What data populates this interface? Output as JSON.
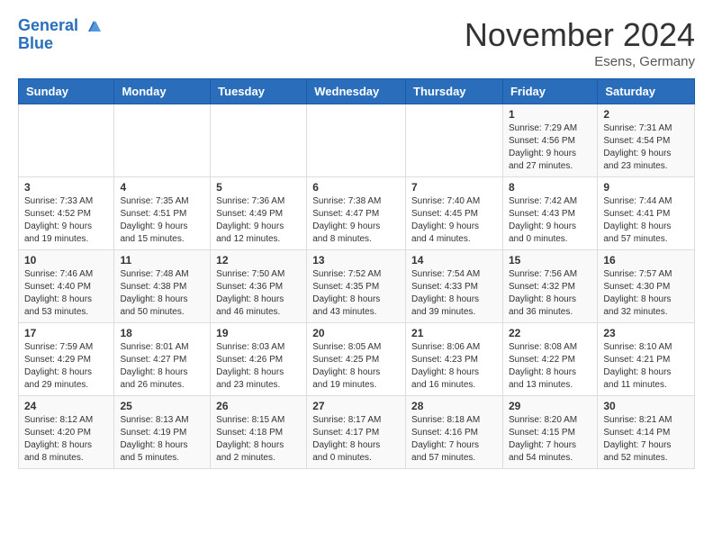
{
  "header": {
    "logo_line1": "General",
    "logo_line2": "Blue",
    "month_title": "November 2024",
    "location": "Esens, Germany"
  },
  "days_of_week": [
    "Sunday",
    "Monday",
    "Tuesday",
    "Wednesday",
    "Thursday",
    "Friday",
    "Saturday"
  ],
  "weeks": [
    [
      {
        "num": "",
        "info": ""
      },
      {
        "num": "",
        "info": ""
      },
      {
        "num": "",
        "info": ""
      },
      {
        "num": "",
        "info": ""
      },
      {
        "num": "",
        "info": ""
      },
      {
        "num": "1",
        "info": "Sunrise: 7:29 AM\nSunset: 4:56 PM\nDaylight: 9 hours\nand 27 minutes."
      },
      {
        "num": "2",
        "info": "Sunrise: 7:31 AM\nSunset: 4:54 PM\nDaylight: 9 hours\nand 23 minutes."
      }
    ],
    [
      {
        "num": "3",
        "info": "Sunrise: 7:33 AM\nSunset: 4:52 PM\nDaylight: 9 hours\nand 19 minutes."
      },
      {
        "num": "4",
        "info": "Sunrise: 7:35 AM\nSunset: 4:51 PM\nDaylight: 9 hours\nand 15 minutes."
      },
      {
        "num": "5",
        "info": "Sunrise: 7:36 AM\nSunset: 4:49 PM\nDaylight: 9 hours\nand 12 minutes."
      },
      {
        "num": "6",
        "info": "Sunrise: 7:38 AM\nSunset: 4:47 PM\nDaylight: 9 hours\nand 8 minutes."
      },
      {
        "num": "7",
        "info": "Sunrise: 7:40 AM\nSunset: 4:45 PM\nDaylight: 9 hours\nand 4 minutes."
      },
      {
        "num": "8",
        "info": "Sunrise: 7:42 AM\nSunset: 4:43 PM\nDaylight: 9 hours\nand 0 minutes."
      },
      {
        "num": "9",
        "info": "Sunrise: 7:44 AM\nSunset: 4:41 PM\nDaylight: 8 hours\nand 57 minutes."
      }
    ],
    [
      {
        "num": "10",
        "info": "Sunrise: 7:46 AM\nSunset: 4:40 PM\nDaylight: 8 hours\nand 53 minutes."
      },
      {
        "num": "11",
        "info": "Sunrise: 7:48 AM\nSunset: 4:38 PM\nDaylight: 8 hours\nand 50 minutes."
      },
      {
        "num": "12",
        "info": "Sunrise: 7:50 AM\nSunset: 4:36 PM\nDaylight: 8 hours\nand 46 minutes."
      },
      {
        "num": "13",
        "info": "Sunrise: 7:52 AM\nSunset: 4:35 PM\nDaylight: 8 hours\nand 43 minutes."
      },
      {
        "num": "14",
        "info": "Sunrise: 7:54 AM\nSunset: 4:33 PM\nDaylight: 8 hours\nand 39 minutes."
      },
      {
        "num": "15",
        "info": "Sunrise: 7:56 AM\nSunset: 4:32 PM\nDaylight: 8 hours\nand 36 minutes."
      },
      {
        "num": "16",
        "info": "Sunrise: 7:57 AM\nSunset: 4:30 PM\nDaylight: 8 hours\nand 32 minutes."
      }
    ],
    [
      {
        "num": "17",
        "info": "Sunrise: 7:59 AM\nSunset: 4:29 PM\nDaylight: 8 hours\nand 29 minutes."
      },
      {
        "num": "18",
        "info": "Sunrise: 8:01 AM\nSunset: 4:27 PM\nDaylight: 8 hours\nand 26 minutes."
      },
      {
        "num": "19",
        "info": "Sunrise: 8:03 AM\nSunset: 4:26 PM\nDaylight: 8 hours\nand 23 minutes."
      },
      {
        "num": "20",
        "info": "Sunrise: 8:05 AM\nSunset: 4:25 PM\nDaylight: 8 hours\nand 19 minutes."
      },
      {
        "num": "21",
        "info": "Sunrise: 8:06 AM\nSunset: 4:23 PM\nDaylight: 8 hours\nand 16 minutes."
      },
      {
        "num": "22",
        "info": "Sunrise: 8:08 AM\nSunset: 4:22 PM\nDaylight: 8 hours\nand 13 minutes."
      },
      {
        "num": "23",
        "info": "Sunrise: 8:10 AM\nSunset: 4:21 PM\nDaylight: 8 hours\nand 11 minutes."
      }
    ],
    [
      {
        "num": "24",
        "info": "Sunrise: 8:12 AM\nSunset: 4:20 PM\nDaylight: 8 hours\nand 8 minutes."
      },
      {
        "num": "25",
        "info": "Sunrise: 8:13 AM\nSunset: 4:19 PM\nDaylight: 8 hours\nand 5 minutes."
      },
      {
        "num": "26",
        "info": "Sunrise: 8:15 AM\nSunset: 4:18 PM\nDaylight: 8 hours\nand 2 minutes."
      },
      {
        "num": "27",
        "info": "Sunrise: 8:17 AM\nSunset: 4:17 PM\nDaylight: 8 hours\nand 0 minutes."
      },
      {
        "num": "28",
        "info": "Sunrise: 8:18 AM\nSunset: 4:16 PM\nDaylight: 7 hours\nand 57 minutes."
      },
      {
        "num": "29",
        "info": "Sunrise: 8:20 AM\nSunset: 4:15 PM\nDaylight: 7 hours\nand 54 minutes."
      },
      {
        "num": "30",
        "info": "Sunrise: 8:21 AM\nSunset: 4:14 PM\nDaylight: 7 hours\nand 52 minutes."
      }
    ]
  ]
}
